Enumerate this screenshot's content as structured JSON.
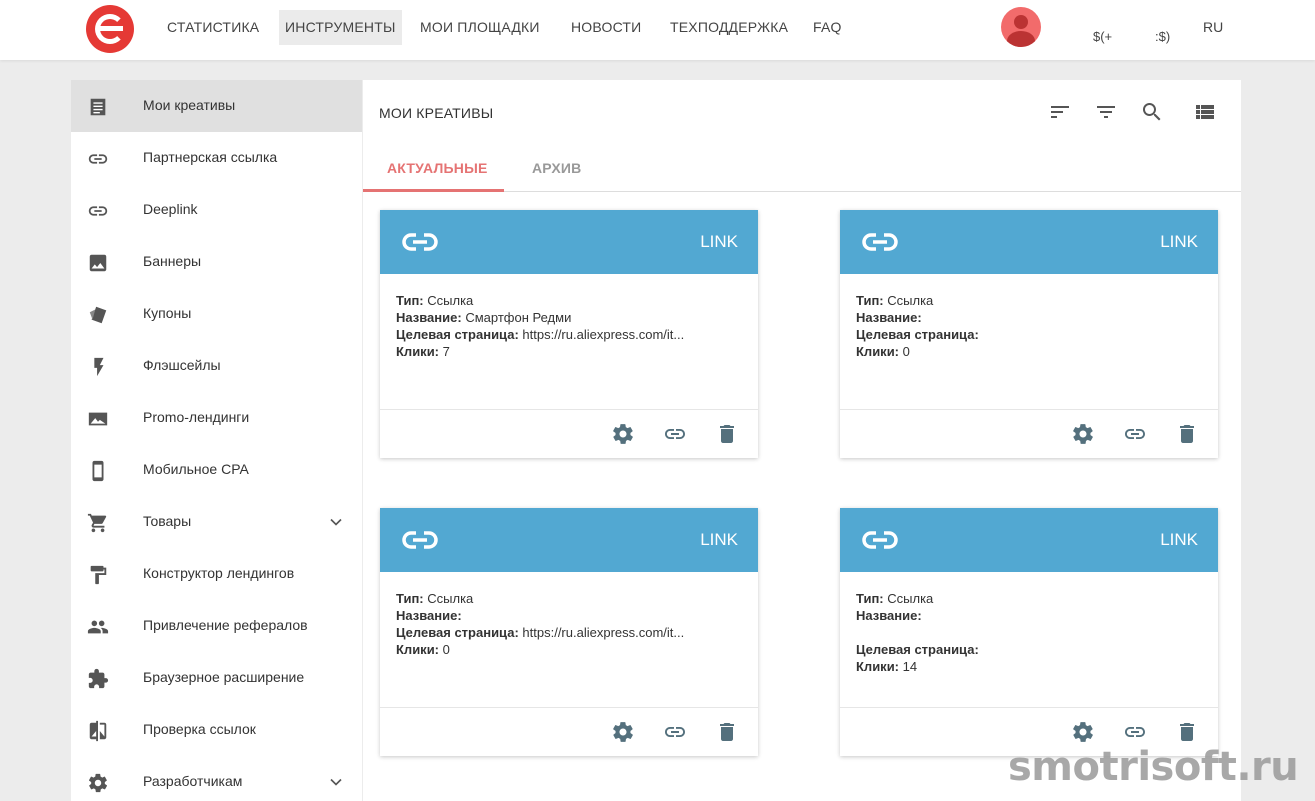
{
  "nav": {
    "items": [
      {
        "label": "СТАТИСТИКА",
        "active": false
      },
      {
        "label": "ИНСТРУМЕНТЫ",
        "active": true
      },
      {
        "label": "МОИ ПЛОЩАДКИ",
        "active": false
      },
      {
        "label": "НОВОСТИ",
        "active": false
      },
      {
        "label": "ТЕХПОДДЕРЖКА",
        "active": false
      },
      {
        "label": "FAQ",
        "active": false
      }
    ],
    "balance1": "$(+",
    "balance2": ":$)",
    "lang": "RU",
    "colors": {
      "logo": "#e53935",
      "avatar": "#f26b6b"
    }
  },
  "sidebar": {
    "items": [
      {
        "label": "Мои креативы",
        "icon": "document-icon",
        "active": true
      },
      {
        "label": "Партнерская ссылка",
        "icon": "link-icon"
      },
      {
        "label": "Deeplink",
        "icon": "link-icon"
      },
      {
        "label": "Баннеры",
        "icon": "image-icon"
      },
      {
        "label": "Купоны",
        "icon": "coupon-icon"
      },
      {
        "label": "Флэшсейлы",
        "icon": "flash-icon"
      },
      {
        "label": "Promo-лендинги",
        "icon": "landscape-icon"
      },
      {
        "label": "Мобильное CPA",
        "icon": "phone-icon"
      },
      {
        "label": "Товары",
        "icon": "cart-icon",
        "expandable": true
      },
      {
        "label": "Конструктор лендингов",
        "icon": "paint-roller-icon"
      },
      {
        "label": "Привлечение рефералов",
        "icon": "people-icon"
      },
      {
        "label": "Браузерное расширение",
        "icon": "puzzle-icon"
      },
      {
        "label": "Проверка ссылок",
        "icon": "compare-icon"
      },
      {
        "label": "Разработчикам",
        "icon": "gear-icon",
        "expandable": true
      }
    ]
  },
  "main": {
    "title": "МОИ КРЕАТИВЫ",
    "tabs": [
      {
        "label": "АКТУАЛЬНЫЕ",
        "active": true,
        "color": "#e57373"
      },
      {
        "label": "АРХИВ",
        "active": false,
        "color": "#999999"
      }
    ],
    "tools": [
      "sort-icon",
      "filter-icon",
      "search-icon",
      "list-view-icon"
    ]
  },
  "cards": [
    {
      "type": "LINK",
      "k_type": "Тип:",
      "v_type": "Ссылка",
      "k_name": "Название:",
      "v_name": "Смартфон Редми",
      "k_target": "Целевая страница:",
      "v_target": "https://ru.aliexpress.com/it...",
      "k_clicks": "Клики:",
      "v_clicks": "7"
    },
    {
      "type": "LINK",
      "k_type": "Тип:",
      "v_type": "Ссылка",
      "k_name": "Название:",
      "v_name": "",
      "k_target": "Целевая страница:",
      "v_target": "",
      "k_clicks": "Клики:",
      "v_clicks": "0"
    },
    {
      "type": "LINK",
      "k_type": "Тип:",
      "v_type": "Ссылка",
      "k_name": "Название:",
      "v_name": "",
      "k_target": "Целевая страница:",
      "v_target": "https://ru.aliexpress.com/it...",
      "k_clicks": "Клики:",
      "v_clicks": "0"
    },
    {
      "type": "LINK",
      "k_type": "Тип:",
      "v_type": "Ссылка",
      "k_name": "Название:",
      "v_name": "",
      "k_target": "Целевая страница:",
      "v_target": "",
      "k_clicks": "Клики:",
      "v_clicks": "14"
    }
  ],
  "card_header_color": "#52a8d2",
  "watermark": "smotrisoft.ru"
}
